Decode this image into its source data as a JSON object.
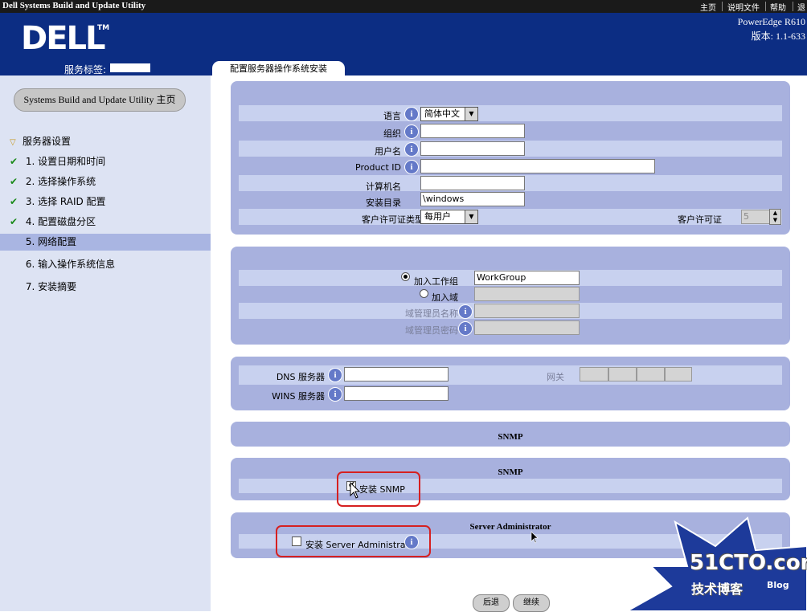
{
  "window": {
    "title": "Dell Systems Build and Update Utility",
    "links": [
      "主页",
      "说明文件",
      "帮助",
      "退"
    ]
  },
  "header": {
    "logo": "DELL",
    "logo_tm": "TM",
    "service_tag_label": "服务标签:",
    "model": "PowerEdge R610",
    "version": "版本: 1.1-633",
    "tab": "配置服务器操作系统安装"
  },
  "sidebar": {
    "home_button": "Systems Build and Update Utility 主页",
    "section": "服务器设置",
    "items": [
      {
        "label": "1. 设置日期和时间",
        "done": true
      },
      {
        "label": "2. 选择操作系统",
        "done": true
      },
      {
        "label": "3. 选择 RAID 配置",
        "done": true
      },
      {
        "label": "4. 配置磁盘分区",
        "done": true
      },
      {
        "label": "5. 网络配置",
        "active": true
      },
      {
        "label": "6. 输入操作系统信息"
      },
      {
        "label": "7. 安装摘要"
      }
    ]
  },
  "os_info": {
    "language_label": "语言",
    "language_value": "简体中文",
    "org_label": "组织",
    "org_value": "",
    "username_label": "用户名",
    "username_value": "",
    "product_id_label": "Product ID",
    "product_id_value": "",
    "computer_name_label": "计算机名",
    "computer_name_value": "",
    "install_dir_label": "安装目录",
    "install_dir_value": "\\windows",
    "license_type_label": "客户许可证类型",
    "license_type_value": "每用户",
    "license_count_label": "客户许可证",
    "license_count_value": "5"
  },
  "network": {
    "workgroup_label": "加入工作组",
    "workgroup_value": "WorkGroup",
    "domain_label": "加入域",
    "domain_admin_label": "域管理员名称",
    "domain_pwd_label": "域管理员密码",
    "dns_label": "DNS 服务器",
    "wins_label": "WINS 服务器",
    "gateway_label": "网关"
  },
  "snmp_collapsed_title": "SNMP",
  "snmp": {
    "title": "SNMP",
    "install_label": "安装 SNMP",
    "checked": true
  },
  "server_admin": {
    "title": "Server Administrator",
    "install_label": "安装 Server Administrator",
    "checked": false
  },
  "buttons": {
    "back": "后退",
    "next": "继续"
  },
  "watermark": {
    "site": "51CTO.com",
    "sub": "技术博客",
    "blog": "Blog"
  },
  "colors": {
    "header": "#0c2d83",
    "panel": "#a8b1de",
    "row": "#c8d1ef",
    "highlight_box": "#d62020"
  }
}
